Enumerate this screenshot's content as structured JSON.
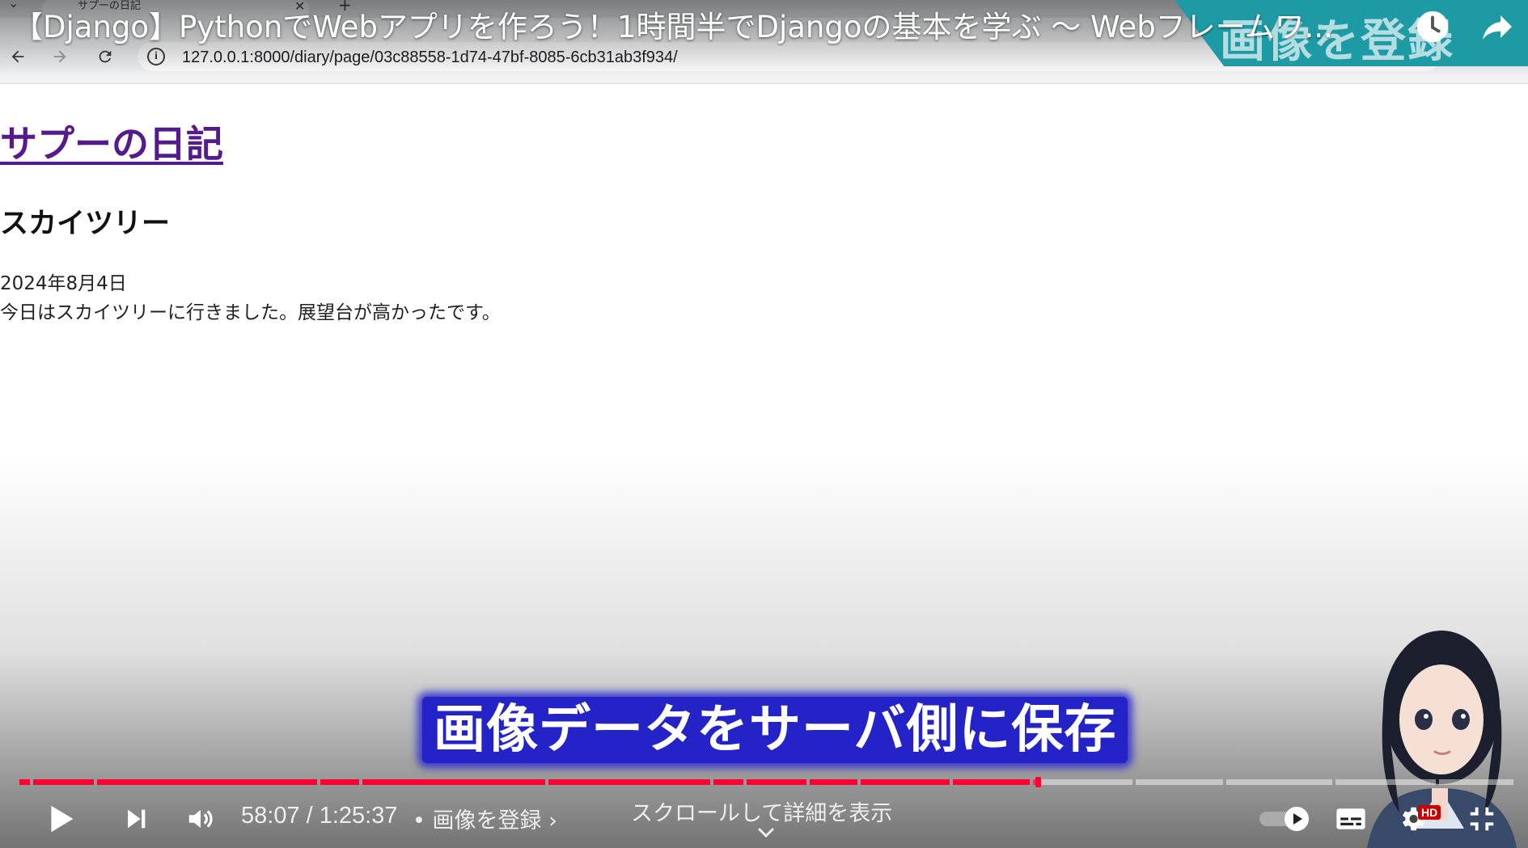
{
  "browser": {
    "tab_title": "サプーの日記",
    "tab_close": "✕",
    "tab_new": "+",
    "tab_list": "⌄",
    "url": "127.0.0.1:8000/diary/page/03c88558-1d74-47bf-8085-6cb31ab3f934/",
    "info_glyph": "i"
  },
  "page": {
    "site_title": "サプーの日記",
    "post_title": "スカイツリー",
    "post_date": "2024年8月4日",
    "post_body": "今日はスカイツリーに行きました。展望台が高かったです。"
  },
  "video": {
    "title": "【Django】PythonでWebアプリを作ろう！1時間半でDjangoの基本を学ぶ 〜 Webフレームワ...",
    "banner_text": "画像を登録",
    "caption": "画像データをサーバ側に保存",
    "time_display": "58:07 / 1:25:37",
    "chapter_label": "• 画像を登録 ›",
    "scroll_hint": "スクロールして詳細を表示",
    "hd_badge": "HD",
    "progress_played_fraction": 0.678,
    "progress_buffered_fraction": 0.68,
    "chapter_boundaries_fraction": [
      0.0,
      0.009,
      0.052,
      0.201,
      0.229,
      0.353,
      0.463,
      0.485,
      0.527,
      0.561,
      0.623,
      0.676,
      0.745,
      0.805,
      0.878,
      0.947,
      0.999
    ],
    "colors": {
      "played": "#ff0033",
      "caption_bg": "#2323c8",
      "banner": "#1e9aa5",
      "link_visited": "#551a8b"
    },
    "icons": {
      "watch_later": "clock-icon",
      "share": "share-arrow-icon",
      "play": "play-icon",
      "next": "next-icon",
      "volume": "volume-icon",
      "autoplay": "autoplay-toggle-icon",
      "subtitles": "subtitles-icon",
      "settings": "gear-icon",
      "exit_fullscreen": "exit-fullscreen-icon"
    }
  }
}
